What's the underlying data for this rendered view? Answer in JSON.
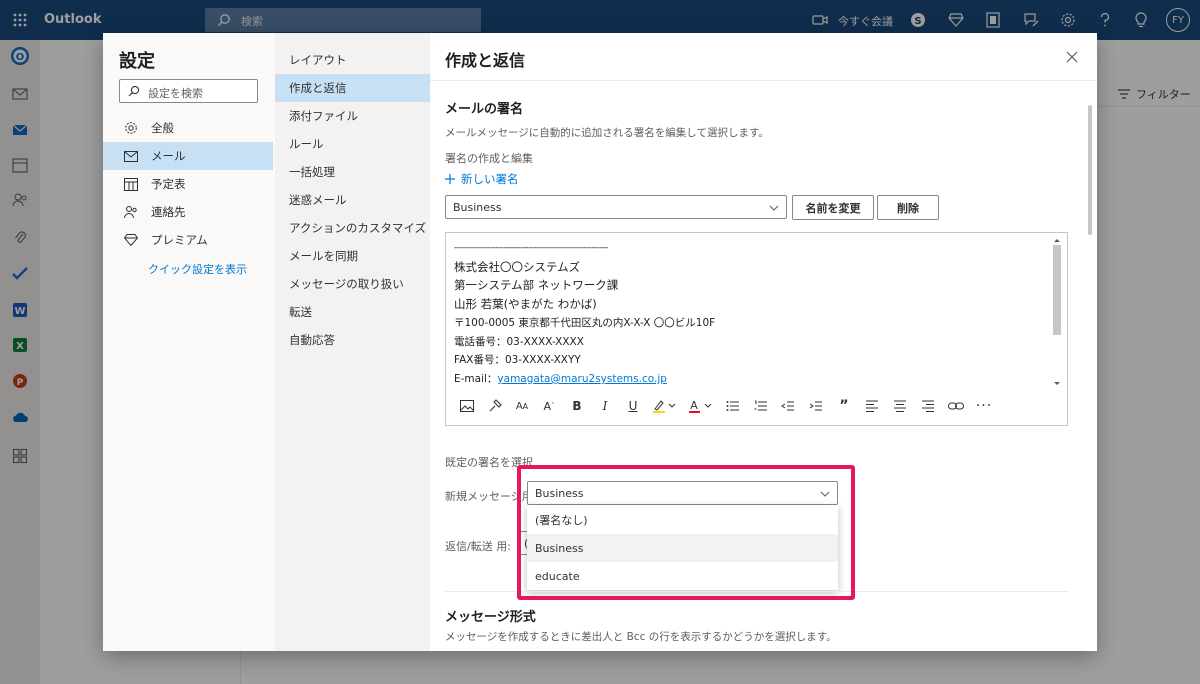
{
  "topbar": {
    "app_name": "Outlook",
    "search_placeholder": "検索",
    "meet_now": "今すぐ会議",
    "avatar_initials": "FY"
  },
  "background": {
    "filter_label": "フィルター"
  },
  "settings": {
    "title": "設定",
    "search_placeholder": "設定を検索",
    "categories": [
      {
        "label": "全般",
        "icon": "gear-icon"
      },
      {
        "label": "メール",
        "icon": "mail-icon"
      },
      {
        "label": "予定表",
        "icon": "calendar-icon"
      },
      {
        "label": "連絡先",
        "icon": "people-icon"
      },
      {
        "label": "プレミアム",
        "icon": "diamond-icon"
      }
    ],
    "quick_settings_link": "クイック設定を表示",
    "subcategories": [
      "レイアウト",
      "作成と返信",
      "添付ファイル",
      "ルール",
      "一括処理",
      "迷惑メール",
      "アクションのカスタマイズ",
      "メールを同期",
      "メッセージの取り扱い",
      "転送",
      "自動応答"
    ],
    "selected_category": "メール",
    "selected_subcategory": "作成と返信"
  },
  "content": {
    "title": "作成と返信",
    "signature_heading": "メールの署名",
    "signature_desc": "メールメッセージに自動的に追加される署名を編集して選択します。",
    "create_edit_label": "署名の作成と編集",
    "new_signature": "新しい署名",
    "signature_select_value": "Business",
    "rename_button": "名前を変更",
    "delete_button": "削除",
    "signature_lines": [
      "--------------------------------------------------------",
      "株式会社〇〇システムズ",
      "第一システム部 ネットワーク課",
      "山形 若葉(やまがた わかば)",
      "〒100-0005 東京都千代田区丸の内X-X-X 〇〇ビル10F",
      "電話番号：03-XXXX-XXXX",
      "FAX番号：03-XXXX-XXYY"
    ],
    "email_label": "E-mail：",
    "email_value": "yamagata@maru2systems.co.jp",
    "toolbar_icons": [
      "image-icon",
      "format-painter-icon",
      "font-size-icon",
      "superscript-icon",
      "bold-icon",
      "italic-icon",
      "underline-icon",
      "highlight-icon",
      "font-color-icon",
      "bullets-icon",
      "numbering-icon",
      "outdent-icon",
      "indent-icon",
      "quote-icon",
      "align-left-icon",
      "align-center-icon",
      "align-right-icon",
      "link-icon",
      "more-icon"
    ],
    "default_sig_label": "既定の署名を選択",
    "new_messages_label": "新規メッセージ用:",
    "new_messages_value": "Business",
    "reply_forward_label": "返信/転送 用:",
    "reply_forward_value": "(",
    "dropdown_options": [
      "(署名なし)",
      "Business",
      "educate"
    ],
    "message_format_heading": "メッセージ形式",
    "message_format_desc": "メッセージを作成するときに差出人と Bcc の行を表示するかどうかを選択します。"
  },
  "colors": {
    "topbar": "#1b4a7c",
    "accent": "#0078d4",
    "selected": "#c7e0f4",
    "highlight_box": "#e8175d"
  }
}
